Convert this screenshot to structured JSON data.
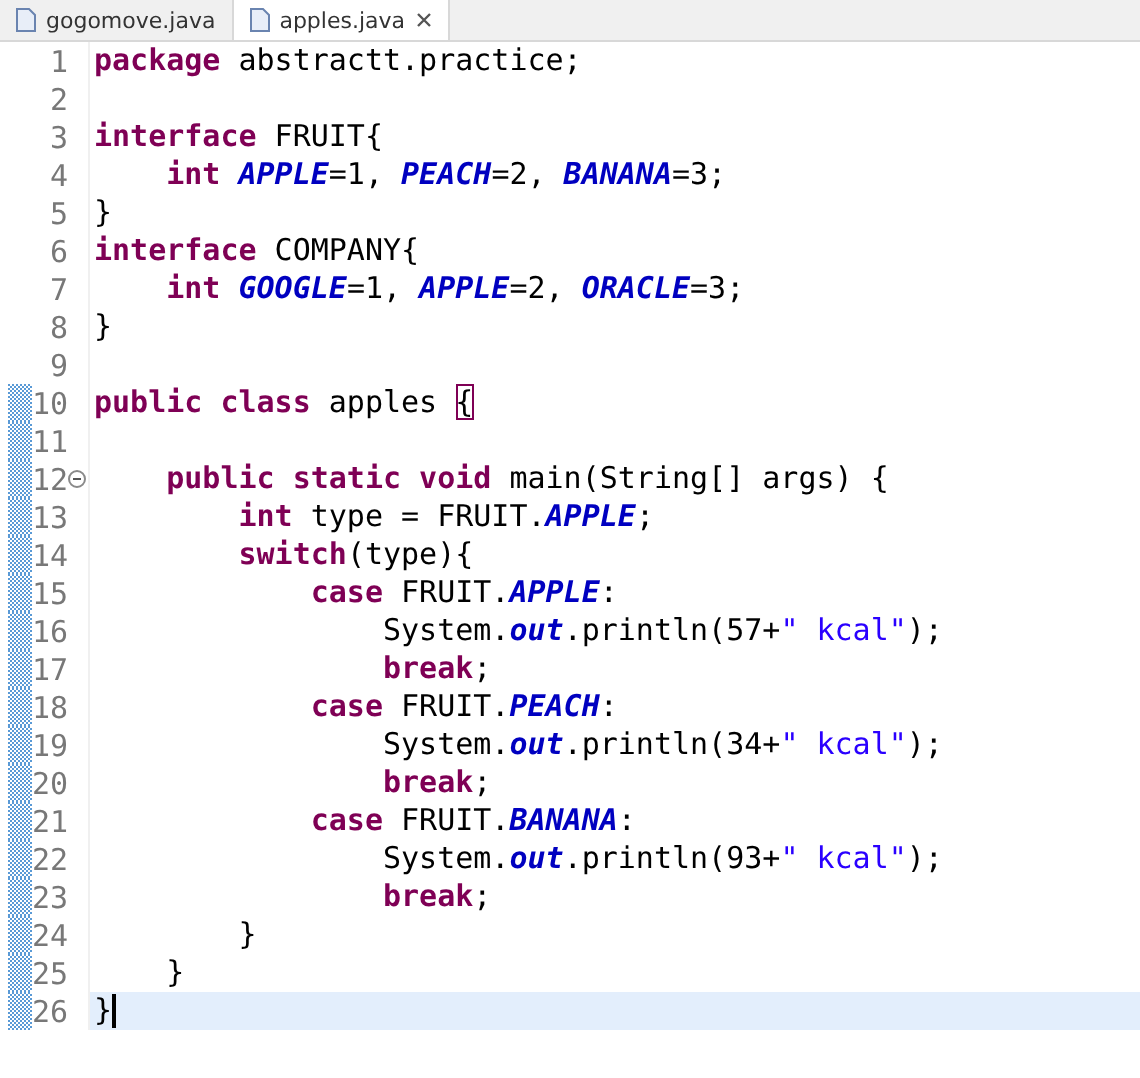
{
  "tabs": [
    {
      "label": "gogomove.java",
      "selected": false,
      "closable": false
    },
    {
      "label": "apples.java",
      "selected": true,
      "closable": true
    }
  ],
  "lines": [
    {
      "number": "1",
      "changed": false,
      "fold": false,
      "current": false,
      "tokens": [
        {
          "kind": "keyword",
          "text": "package"
        },
        {
          "kind": "plain",
          "text": " abstractt.practice;"
        }
      ]
    },
    {
      "number": "2",
      "changed": false,
      "fold": false,
      "current": false
    },
    {
      "number": "3",
      "changed": false,
      "fold": false,
      "current": false,
      "tokens": [
        {
          "kind": "keyword",
          "text": "interface"
        },
        {
          "kind": "plain",
          "text": " FRUIT{"
        }
      ]
    },
    {
      "number": "4",
      "changed": false,
      "fold": false,
      "current": false,
      "tokens": [
        {
          "kind": "keyword",
          "text": "    int"
        },
        {
          "kind": "constant",
          "text": " APPLE"
        },
        {
          "kind": "plain",
          "text": "=1,"
        },
        {
          "kind": "constant",
          "text": " PEACH"
        },
        {
          "kind": "plain",
          "text": "=2,"
        },
        {
          "kind": "constant",
          "text": " BANANA"
        },
        {
          "kind": "plain",
          "text": "=3;"
        }
      ]
    },
    {
      "number": "5",
      "changed": false,
      "fold": false,
      "current": false,
      "tokens": [
        {
          "kind": "plain",
          "text": "}"
        }
      ]
    },
    {
      "number": "6",
      "changed": false,
      "fold": false,
      "current": false,
      "tokens": [
        {
          "kind": "keyword",
          "text": "interface"
        },
        {
          "kind": "plain",
          "text": " COMPANY{"
        }
      ]
    },
    {
      "number": "7",
      "changed": false,
      "fold": false,
      "current": false,
      "tokens": [
        {
          "kind": "keyword",
          "text": "    int"
        },
        {
          "kind": "constant",
          "text": " GOOGLE"
        },
        {
          "kind": "plain",
          "text": "=1,"
        },
        {
          "kind": "constant",
          "text": " APPLE"
        },
        {
          "kind": "plain",
          "text": "=2,"
        },
        {
          "kind": "constant",
          "text": " ORACLE"
        },
        {
          "kind": "plain",
          "text": "=3;"
        }
      ]
    },
    {
      "number": "8",
      "changed": false,
      "fold": false,
      "current": false,
      "tokens": [
        {
          "kind": "plain",
          "text": "}"
        }
      ]
    },
    {
      "number": "9",
      "changed": false,
      "fold": false,
      "current": false
    },
    {
      "number": "10",
      "changed": true,
      "fold": false,
      "current": false,
      "tokens": [
        {
          "kind": "keyword",
          "text": "public class"
        },
        {
          "kind": "plain",
          "text": " apples "
        },
        {
          "kind": "bracket-match",
          "text": "{"
        }
      ]
    },
    {
      "number": "11",
      "changed": true,
      "fold": false,
      "current": false
    },
    {
      "number": "12",
      "changed": true,
      "fold": true,
      "current": false,
      "tokens": [
        {
          "kind": "keyword",
          "text": "    public static void"
        },
        {
          "kind": "plain",
          "text": " main(String[] args) {"
        }
      ]
    },
    {
      "number": "13",
      "changed": true,
      "fold": false,
      "current": false,
      "tokens": [
        {
          "kind": "keyword",
          "text": "        int"
        },
        {
          "kind": "plain",
          "text": " type = FRUIT."
        },
        {
          "kind": "constant",
          "text": "APPLE"
        },
        {
          "kind": "plain",
          "text": ";"
        }
      ]
    },
    {
      "number": "14",
      "changed": true,
      "fold": false,
      "current": false,
      "tokens": [
        {
          "kind": "keyword",
          "text": "        switch"
        },
        {
          "kind": "plain",
          "text": "(type){"
        }
      ]
    },
    {
      "number": "15",
      "changed": true,
      "fold": false,
      "current": false,
      "tokens": [
        {
          "kind": "keyword",
          "text": "            case"
        },
        {
          "kind": "plain",
          "text": " FRUIT."
        },
        {
          "kind": "constant",
          "text": "APPLE"
        },
        {
          "kind": "plain",
          "text": ":"
        }
      ]
    },
    {
      "number": "16",
      "changed": true,
      "fold": false,
      "current": false,
      "tokens": [
        {
          "kind": "plain",
          "text": "                System."
        },
        {
          "kind": "constant",
          "text": "out"
        },
        {
          "kind": "plain",
          "text": ".println(57+"
        },
        {
          "kind": "string",
          "text": "\" kcal\""
        },
        {
          "kind": "plain",
          "text": ");"
        }
      ]
    },
    {
      "number": "17",
      "changed": true,
      "fold": false,
      "current": false,
      "tokens": [
        {
          "kind": "keyword",
          "text": "                break"
        },
        {
          "kind": "plain",
          "text": ";"
        }
      ]
    },
    {
      "number": "18",
      "changed": true,
      "fold": false,
      "current": false,
      "tokens": [
        {
          "kind": "keyword",
          "text": "            case"
        },
        {
          "kind": "plain",
          "text": " FRUIT."
        },
        {
          "kind": "constant",
          "text": "PEACH"
        },
        {
          "kind": "plain",
          "text": ":"
        }
      ]
    },
    {
      "number": "19",
      "changed": true,
      "fold": false,
      "current": false,
      "tokens": [
        {
          "kind": "plain",
          "text": "                System."
        },
        {
          "kind": "constant",
          "text": "out"
        },
        {
          "kind": "plain",
          "text": ".println(34+"
        },
        {
          "kind": "string",
          "text": "\" kcal\""
        },
        {
          "kind": "plain",
          "text": ");"
        }
      ]
    },
    {
      "number": "20",
      "changed": true,
      "fold": false,
      "current": false,
      "tokens": [
        {
          "kind": "keyword",
          "text": "                break"
        },
        {
          "kind": "plain",
          "text": ";"
        }
      ]
    },
    {
      "number": "21",
      "changed": true,
      "fold": false,
      "current": false,
      "tokens": [
        {
          "kind": "keyword",
          "text": "            case"
        },
        {
          "kind": "plain",
          "text": " FRUIT."
        },
        {
          "kind": "constant",
          "text": "BANANA"
        },
        {
          "kind": "plain",
          "text": ":"
        }
      ]
    },
    {
      "number": "22",
      "changed": true,
      "fold": false,
      "current": false,
      "tokens": [
        {
          "kind": "plain",
          "text": "                System."
        },
        {
          "kind": "constant",
          "text": "out"
        },
        {
          "kind": "plain",
          "text": ".println(93+"
        },
        {
          "kind": "string",
          "text": "\" kcal\""
        },
        {
          "kind": "plain",
          "text": ");"
        }
      ]
    },
    {
      "number": "23",
      "changed": true,
      "fold": false,
      "current": false,
      "tokens": [
        {
          "kind": "keyword",
          "text": "                break"
        },
        {
          "kind": "plain",
          "text": ";"
        }
      ]
    },
    {
      "number": "24",
      "changed": true,
      "fold": false,
      "current": false,
      "tokens": [
        {
          "kind": "plain",
          "text": "        }"
        }
      ]
    },
    {
      "number": "25",
      "changed": true,
      "fold": false,
      "current": false,
      "tokens": [
        {
          "kind": "plain",
          "text": "    }"
        }
      ]
    },
    {
      "number": "26",
      "changed": true,
      "fold": false,
      "current": true,
      "tokens": [
        {
          "kind": "plain",
          "text": "}"
        }
      ]
    }
  ]
}
